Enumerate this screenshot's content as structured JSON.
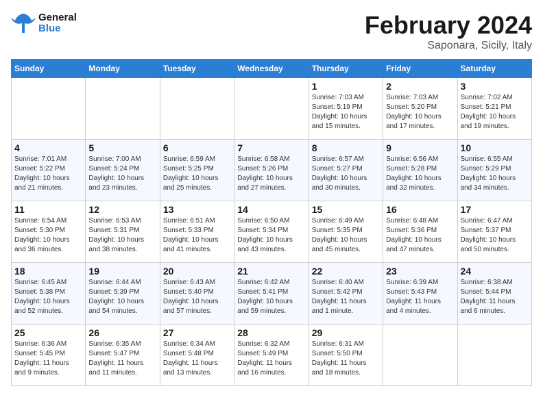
{
  "header": {
    "logo_general": "General",
    "logo_blue": "Blue",
    "title": "February 2024",
    "subtitle": "Saponara, Sicily, Italy"
  },
  "days_of_week": [
    "Sunday",
    "Monday",
    "Tuesday",
    "Wednesday",
    "Thursday",
    "Friday",
    "Saturday"
  ],
  "weeks": [
    [
      {
        "num": "",
        "info": ""
      },
      {
        "num": "",
        "info": ""
      },
      {
        "num": "",
        "info": ""
      },
      {
        "num": "",
        "info": ""
      },
      {
        "num": "1",
        "info": "Sunrise: 7:03 AM\nSunset: 5:19 PM\nDaylight: 10 hours\nand 15 minutes."
      },
      {
        "num": "2",
        "info": "Sunrise: 7:03 AM\nSunset: 5:20 PM\nDaylight: 10 hours\nand 17 minutes."
      },
      {
        "num": "3",
        "info": "Sunrise: 7:02 AM\nSunset: 5:21 PM\nDaylight: 10 hours\nand 19 minutes."
      }
    ],
    [
      {
        "num": "4",
        "info": "Sunrise: 7:01 AM\nSunset: 5:22 PM\nDaylight: 10 hours\nand 21 minutes."
      },
      {
        "num": "5",
        "info": "Sunrise: 7:00 AM\nSunset: 5:24 PM\nDaylight: 10 hours\nand 23 minutes."
      },
      {
        "num": "6",
        "info": "Sunrise: 6:59 AM\nSunset: 5:25 PM\nDaylight: 10 hours\nand 25 minutes."
      },
      {
        "num": "7",
        "info": "Sunrise: 6:58 AM\nSunset: 5:26 PM\nDaylight: 10 hours\nand 27 minutes."
      },
      {
        "num": "8",
        "info": "Sunrise: 6:57 AM\nSunset: 5:27 PM\nDaylight: 10 hours\nand 30 minutes."
      },
      {
        "num": "9",
        "info": "Sunrise: 6:56 AM\nSunset: 5:28 PM\nDaylight: 10 hours\nand 32 minutes."
      },
      {
        "num": "10",
        "info": "Sunrise: 6:55 AM\nSunset: 5:29 PM\nDaylight: 10 hours\nand 34 minutes."
      }
    ],
    [
      {
        "num": "11",
        "info": "Sunrise: 6:54 AM\nSunset: 5:30 PM\nDaylight: 10 hours\nand 36 minutes."
      },
      {
        "num": "12",
        "info": "Sunrise: 6:53 AM\nSunset: 5:31 PM\nDaylight: 10 hours\nand 38 minutes."
      },
      {
        "num": "13",
        "info": "Sunrise: 6:51 AM\nSunset: 5:33 PM\nDaylight: 10 hours\nand 41 minutes."
      },
      {
        "num": "14",
        "info": "Sunrise: 6:50 AM\nSunset: 5:34 PM\nDaylight: 10 hours\nand 43 minutes."
      },
      {
        "num": "15",
        "info": "Sunrise: 6:49 AM\nSunset: 5:35 PM\nDaylight: 10 hours\nand 45 minutes."
      },
      {
        "num": "16",
        "info": "Sunrise: 6:48 AM\nSunset: 5:36 PM\nDaylight: 10 hours\nand 47 minutes."
      },
      {
        "num": "17",
        "info": "Sunrise: 6:47 AM\nSunset: 5:37 PM\nDaylight: 10 hours\nand 50 minutes."
      }
    ],
    [
      {
        "num": "18",
        "info": "Sunrise: 6:45 AM\nSunset: 5:38 PM\nDaylight: 10 hours\nand 52 minutes."
      },
      {
        "num": "19",
        "info": "Sunrise: 6:44 AM\nSunset: 5:39 PM\nDaylight: 10 hours\nand 54 minutes."
      },
      {
        "num": "20",
        "info": "Sunrise: 6:43 AM\nSunset: 5:40 PM\nDaylight: 10 hours\nand 57 minutes."
      },
      {
        "num": "21",
        "info": "Sunrise: 6:42 AM\nSunset: 5:41 PM\nDaylight: 10 hours\nand 59 minutes."
      },
      {
        "num": "22",
        "info": "Sunrise: 6:40 AM\nSunset: 5:42 PM\nDaylight: 11 hours\nand 1 minute."
      },
      {
        "num": "23",
        "info": "Sunrise: 6:39 AM\nSunset: 5:43 PM\nDaylight: 11 hours\nand 4 minutes."
      },
      {
        "num": "24",
        "info": "Sunrise: 6:38 AM\nSunset: 5:44 PM\nDaylight: 11 hours\nand 6 minutes."
      }
    ],
    [
      {
        "num": "25",
        "info": "Sunrise: 6:36 AM\nSunset: 5:45 PM\nDaylight: 11 hours\nand 9 minutes."
      },
      {
        "num": "26",
        "info": "Sunrise: 6:35 AM\nSunset: 5:47 PM\nDaylight: 11 hours\nand 11 minutes."
      },
      {
        "num": "27",
        "info": "Sunrise: 6:34 AM\nSunset: 5:48 PM\nDaylight: 11 hours\nand 13 minutes."
      },
      {
        "num": "28",
        "info": "Sunrise: 6:32 AM\nSunset: 5:49 PM\nDaylight: 11 hours\nand 16 minutes."
      },
      {
        "num": "29",
        "info": "Sunrise: 6:31 AM\nSunset: 5:50 PM\nDaylight: 11 hours\nand 18 minutes."
      },
      {
        "num": "",
        "info": ""
      },
      {
        "num": "",
        "info": ""
      }
    ]
  ]
}
